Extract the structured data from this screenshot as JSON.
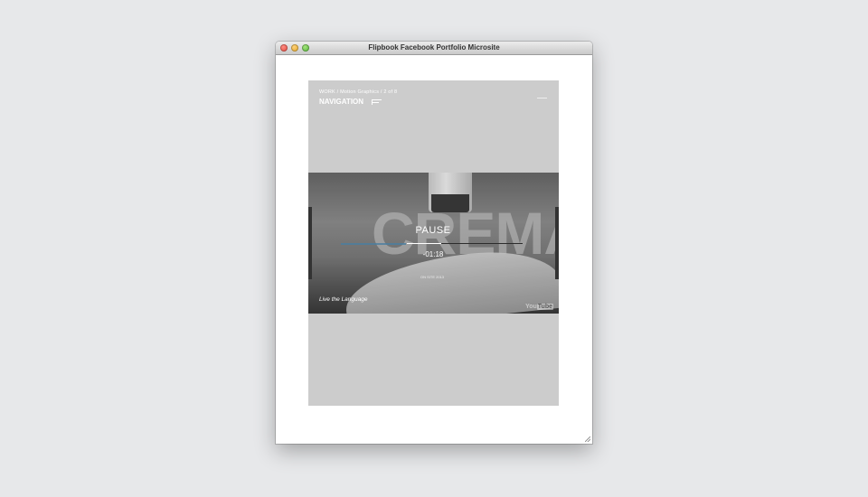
{
  "window": {
    "title": "Flipbook Facebook Portfolio Microsite"
  },
  "header": {
    "breadcrumb": "WORK / Motion Graphics / 2 of 8",
    "nav_label": "NAVIGATION"
  },
  "video": {
    "title_overlay": "CREMA",
    "state_label": "PAUSE",
    "time_remaining": "-01:18",
    "progress_fraction": 0.3,
    "caption_small": "ON SITE 2013",
    "tagline": "Live the Language",
    "player_brand": "You",
    "player_brand_tube": "Tube"
  },
  "colors": {
    "desktop": "#e7e8ea",
    "page_panel": "#cccccc",
    "buffer_bar": "#4b7ea0"
  }
}
